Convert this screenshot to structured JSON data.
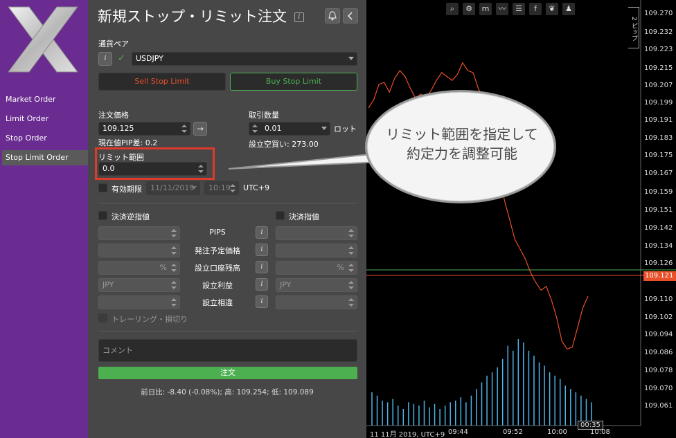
{
  "sidebar": {
    "items": [
      {
        "label": "Market Order"
      },
      {
        "label": "Limit Order"
      },
      {
        "label": "Stop Order"
      },
      {
        "label": "Stop Limit Order"
      }
    ]
  },
  "panel": {
    "title": "新規ストップ・リミット注文",
    "info_icon": "i",
    "currency_pair_label": "通貨ペア",
    "currency_pair_value": "USDJPY",
    "sell_button": "Sell Stop Limit",
    "buy_button": "Buy Stop Limit",
    "order_price_label": "注文価格",
    "order_price_value": "109.125",
    "pip_diff": "現在値PIP差: 0.2",
    "quantity_label": "取引数量",
    "quantity_value": "0.01",
    "lot_label": "ロット",
    "margin_text": "設立空買い: 273.00",
    "limit_range_label": "リミット範囲",
    "limit_range_value": "0.0",
    "expiry_label": "有効期限",
    "expiry_date": "11/11/2019",
    "expiry_time": "10:19",
    "timezone": "UTC+9",
    "stop_loss_label": "決済逆指値",
    "take_profit_label": "決済指値",
    "rows": [
      {
        "label": "PIPS",
        "left": "",
        "right": ""
      },
      {
        "label": "発注予定価格",
        "left": "",
        "right": ""
      },
      {
        "label": "設立口座残高",
        "left": "%",
        "right": "%"
      },
      {
        "label": "設立利益",
        "left": "JPY",
        "right": "JPY"
      },
      {
        "label": "設立相違",
        "left": "",
        "right": ""
      }
    ],
    "trailing_label": "トレーリング・損切り",
    "comment_placeholder": "コメント",
    "order_button": "注文",
    "summary": "前日比: -8.40 (-0.08%); 高: 109.254; 低: 109.089"
  },
  "callout": {
    "text": "リミット範囲を指定して約定力を調整可能"
  },
  "chart": {
    "scale_label": "2 ピップ",
    "y_labels": [
      "109.270",
      "109.232",
      "109.223",
      "109.215",
      "109.207",
      "109.199",
      "109.191",
      "109.183",
      "109.175",
      "109.167",
      "109.159",
      "109.151",
      "109.142",
      "109.134",
      "109.126",
      "109.121",
      "109.110",
      "109.102",
      "109.094",
      "109.086",
      "109.078",
      "109.070",
      "109.061"
    ],
    "current_price": "109.121",
    "x_labels": [
      "11 11月 2019, UTC+9",
      "09:44",
      "09:52",
      "10:00",
      "00:35",
      "10:08"
    ],
    "toolbar": [
      "zoom-icon",
      "settings-icon",
      "m1",
      "line-icon",
      "list-icon",
      "facebook-icon",
      "leaf-icon",
      "person-icon"
    ],
    "colors": {
      "line": "#e8502a",
      "volume": "#4fb3e8",
      "price_tag": "#e8502a",
      "green_line": "#4caf50"
    }
  },
  "chart_data": {
    "type": "line",
    "series": [
      {
        "values": [
          109.217,
          109.221,
          109.229,
          109.23,
          109.225,
          109.232,
          109.236,
          109.233,
          109.227,
          109.222,
          109.224,
          109.222,
          109.226,
          109.231,
          109.235,
          109.233,
          109.231,
          109.234,
          109.24,
          109.236,
          109.235,
          109.227,
          109.221,
          109.217,
          109.2,
          109.185,
          109.17,
          109.16,
          109.15,
          109.145,
          109.14,
          109.133,
          109.128,
          109.124,
          109.126,
          109.119,
          109.11,
          109.098,
          109.094,
          109.095,
          109.105,
          109.115,
          109.121
        ]
      },
      {
        "values": [
          20,
          18,
          15,
          14,
          16,
          12,
          10,
          14,
          13,
          12,
          15,
          11,
          13,
          10,
          12,
          14,
          15,
          17,
          14,
          18,
          22,
          26,
          30,
          32,
          35,
          40,
          48,
          45,
          52,
          50,
          45,
          42,
          38,
          36,
          32,
          30,
          28,
          24,
          22,
          20,
          18,
          16,
          14
        ]
      }
    ],
    "ylim": [
      109.055,
      109.272
    ]
  }
}
